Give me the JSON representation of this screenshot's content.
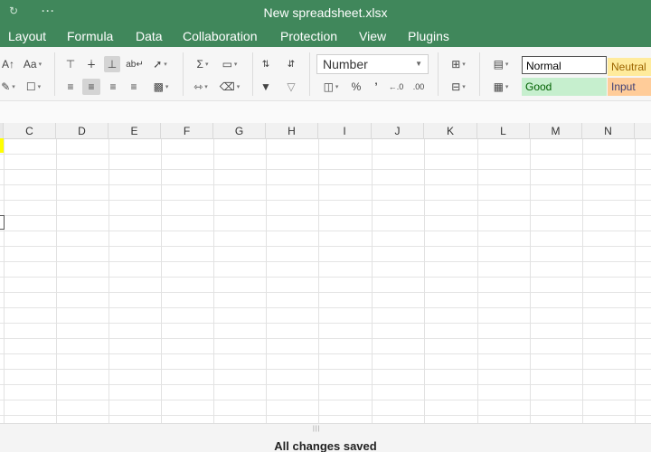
{
  "window": {
    "title": "New spreadsheet.xlsx",
    "redo_icon": "redo-icon",
    "more_label": "···"
  },
  "menu": {
    "items": [
      "Layout",
      "Formula",
      "Data",
      "Collaboration",
      "Protection",
      "View",
      "Plugins"
    ]
  },
  "toolbar": {
    "number_format": "Number",
    "styles": {
      "normal": "Normal",
      "neutral": "Neutral",
      "good": "Good",
      "input": "Input"
    },
    "percent": "%",
    "comma": "’"
  },
  "columns": [
    "C",
    "D",
    "E",
    "F",
    "G",
    "H",
    "I",
    "J",
    "K",
    "L",
    "M",
    "N"
  ],
  "status": {
    "text": "All changes saved"
  },
  "colors": {
    "brand": "#40875b",
    "selected_cell": "#ffff00",
    "neutral_bg": "#ffeb9c",
    "good_bg": "#c6efce",
    "input_bg": "#ffcc99"
  }
}
